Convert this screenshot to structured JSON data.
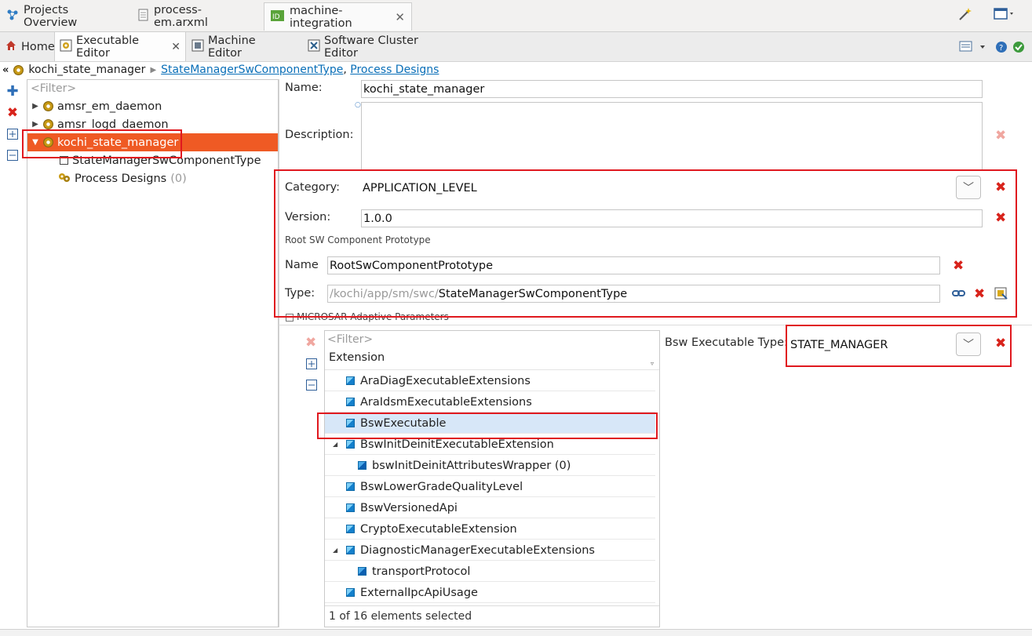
{
  "top_tabs": [
    {
      "label": "Projects Overview",
      "icon": "projects-overview-icon"
    },
    {
      "label": "process-em.arxml",
      "icon": "arxml-file-icon"
    },
    {
      "label": "machine-integration",
      "icon": "machine-integration-icon",
      "active": true
    }
  ],
  "editor_tabs": [
    {
      "label": "Home",
      "icon": "home-icon"
    },
    {
      "label": "Executable Editor",
      "icon": "executable-editor-icon",
      "active": true
    },
    {
      "label": "Machine Editor",
      "icon": "machine-editor-icon"
    },
    {
      "label": "Software Cluster Editor",
      "icon": "software-cluster-icon"
    }
  ],
  "breadcrumb": {
    "item": "kochi_state_manager",
    "link1": "StateManagerSwComponentType",
    "separator": ",",
    "link2": "Process Designs"
  },
  "tree": {
    "filter_placeholder": "<Filter>",
    "items": [
      {
        "label": "amsr_em_daemon",
        "expander": "collapsed"
      },
      {
        "label": "amsr_logd_daemon",
        "expander": "collapsed"
      },
      {
        "label": "kochi_state_manager",
        "expander": "expanded",
        "selected": true
      },
      {
        "label": "StateManagerSwComponentType"
      },
      {
        "label": "Process Designs",
        "count": "(0)"
      }
    ]
  },
  "form": {
    "name_label": "Name:",
    "name_value": "kochi_state_manager",
    "description_label": "Description:",
    "description_value": "",
    "category_label": "Category:",
    "category_value": "APPLICATION_LEVEL",
    "version_label": "Version:",
    "version_value": "1.0.0",
    "root_section_label": "Root SW Component Prototype",
    "root_name_label": "Name",
    "root_name_value": "RootSwComponentPrototype",
    "root_type_label": "Type:",
    "root_type_path_prefix": "/kochi/app/sm/swc/",
    "root_type_path_name": "StateManagerSwComponentType",
    "microsar_section_label": "MICROSAR Adaptive Parameters",
    "bsw_type_label": "Bsw Executable Type:",
    "bsw_type_value": "STATE_MANAGER"
  },
  "extensions": {
    "filter_placeholder": "<Filter>",
    "column_header": "Extension",
    "rows": [
      {
        "label": "AraDiagExecutableExtensions",
        "indent": 0
      },
      {
        "label": "AraIdsmExecutableExtensions",
        "indent": 0
      },
      {
        "label": "BswExecutable",
        "indent": 0,
        "selected": true
      },
      {
        "label": "BswInitDeinitExecutableExtension",
        "indent": 0,
        "expander": "expanded"
      },
      {
        "label": "bswInitDeinitAttributesWrapper (0)",
        "indent": 1
      },
      {
        "label": "BswLowerGradeQualityLevel",
        "indent": 0
      },
      {
        "label": "BswVersionedApi",
        "indent": 0
      },
      {
        "label": "CryptoExecutableExtension",
        "indent": 0
      },
      {
        "label": "DiagnosticManagerExecutableExtensions",
        "indent": 0,
        "expander": "expanded"
      },
      {
        "label": "transportProtocol",
        "indent": 1
      },
      {
        "label": "ExternalIpcApiUsage",
        "indent": 0
      }
    ],
    "status": "1 of 16 elements selected"
  },
  "colors": {
    "selection": "#ef5a24",
    "highlight_box": "#e0191f",
    "link": "#0a6fb8",
    "delete": "#d8231b"
  }
}
